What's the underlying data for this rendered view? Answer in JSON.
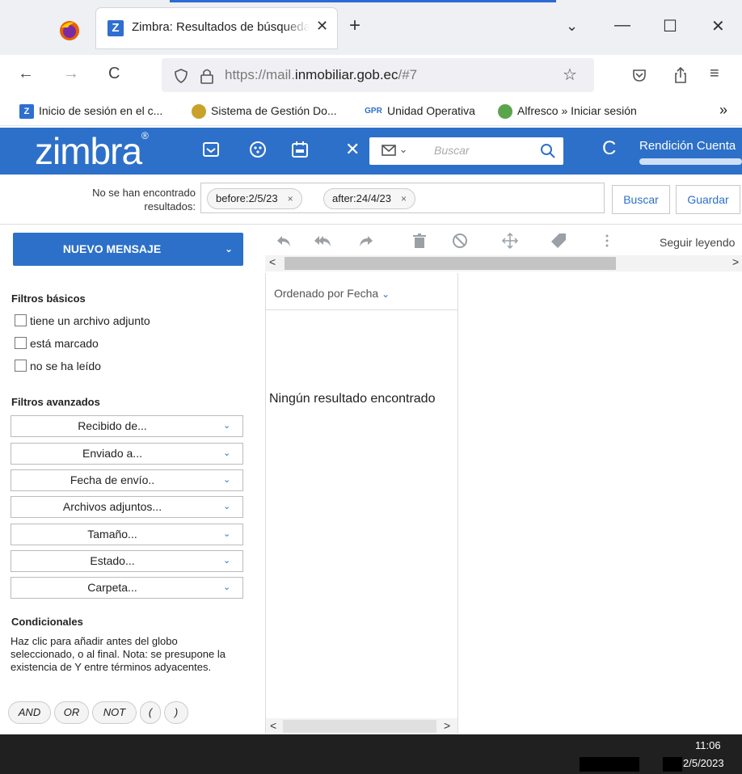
{
  "browser": {
    "tab_title": "Zimbra: Resultados de búsqueda",
    "tab_close": "✕",
    "new_tab": "+",
    "tabs_dropdown": "⌄",
    "minimize": "—",
    "maximize": "☐",
    "close": "✕",
    "url_prefix": "https://mail.",
    "url_domain": "inmobiliar.gob.ec",
    "url_suffix": "/#7",
    "bookmarks": [
      {
        "label": "Inicio de sesión en el c...",
        "icon": "Z"
      },
      {
        "label": "Sistema de Gestión Do...",
        "icon": ""
      },
      {
        "label": "Unidad Operativa",
        "icon": "GPR"
      },
      {
        "label": "Alfresco » Iniciar sesión",
        "icon": ""
      }
    ],
    "more_bookmarks": "»"
  },
  "zimbra": {
    "logo": "zimbra",
    "logo_mark": "®",
    "search_placeholder": "Buscar",
    "search_type_arrow": "⌄",
    "close_search": "✕",
    "refresh": "C",
    "user_label": "Rendición Cuenta",
    "no_results_line1": "No se han encontrado",
    "no_results_line2": "resultados:",
    "chips": [
      {
        "label": "before:2/5/23",
        "x": "×"
      },
      {
        "label": "after:24/4/23",
        "x": "×"
      }
    ],
    "buscar_button": "Buscar",
    "guardar_button": "Guardar"
  },
  "left": {
    "new_message": "NUEVO MENSAJE",
    "new_message_arrow": "⌄",
    "basic_filters_title": "Filtros básicos",
    "basic_filters": [
      "tiene un archivo adjunto",
      "está marcado",
      "no se ha leído"
    ],
    "advanced_filters_title": "Filtros avanzados",
    "advanced_filters": [
      "Recibido de...",
      "Enviado a...",
      "Fecha de envío..",
      "Archivos adjuntos...",
      "Tamaño...",
      "Estado...",
      "Carpeta..."
    ],
    "dropdown_arrow": "⌄",
    "conditionals_title": "Condicionales",
    "conditionals_text": "Haz clic para añadir antes del globo seleccionado, o al final. Nota: se presupone la existencia de Y entre términos adyacentes.",
    "operators": [
      "AND",
      "OR",
      "NOT",
      "(",
      ")"
    ]
  },
  "middle": {
    "reading_pane_label": "Seguir leyendo",
    "sort_label": "Ordenado por Fecha",
    "sort_arrow": "⌄",
    "empty_message": "Ningún resultado encontrado",
    "scroll_left": "<",
    "scroll_right": ">"
  },
  "taskbar": {
    "time": "11:06",
    "date": "2/5/2023"
  }
}
